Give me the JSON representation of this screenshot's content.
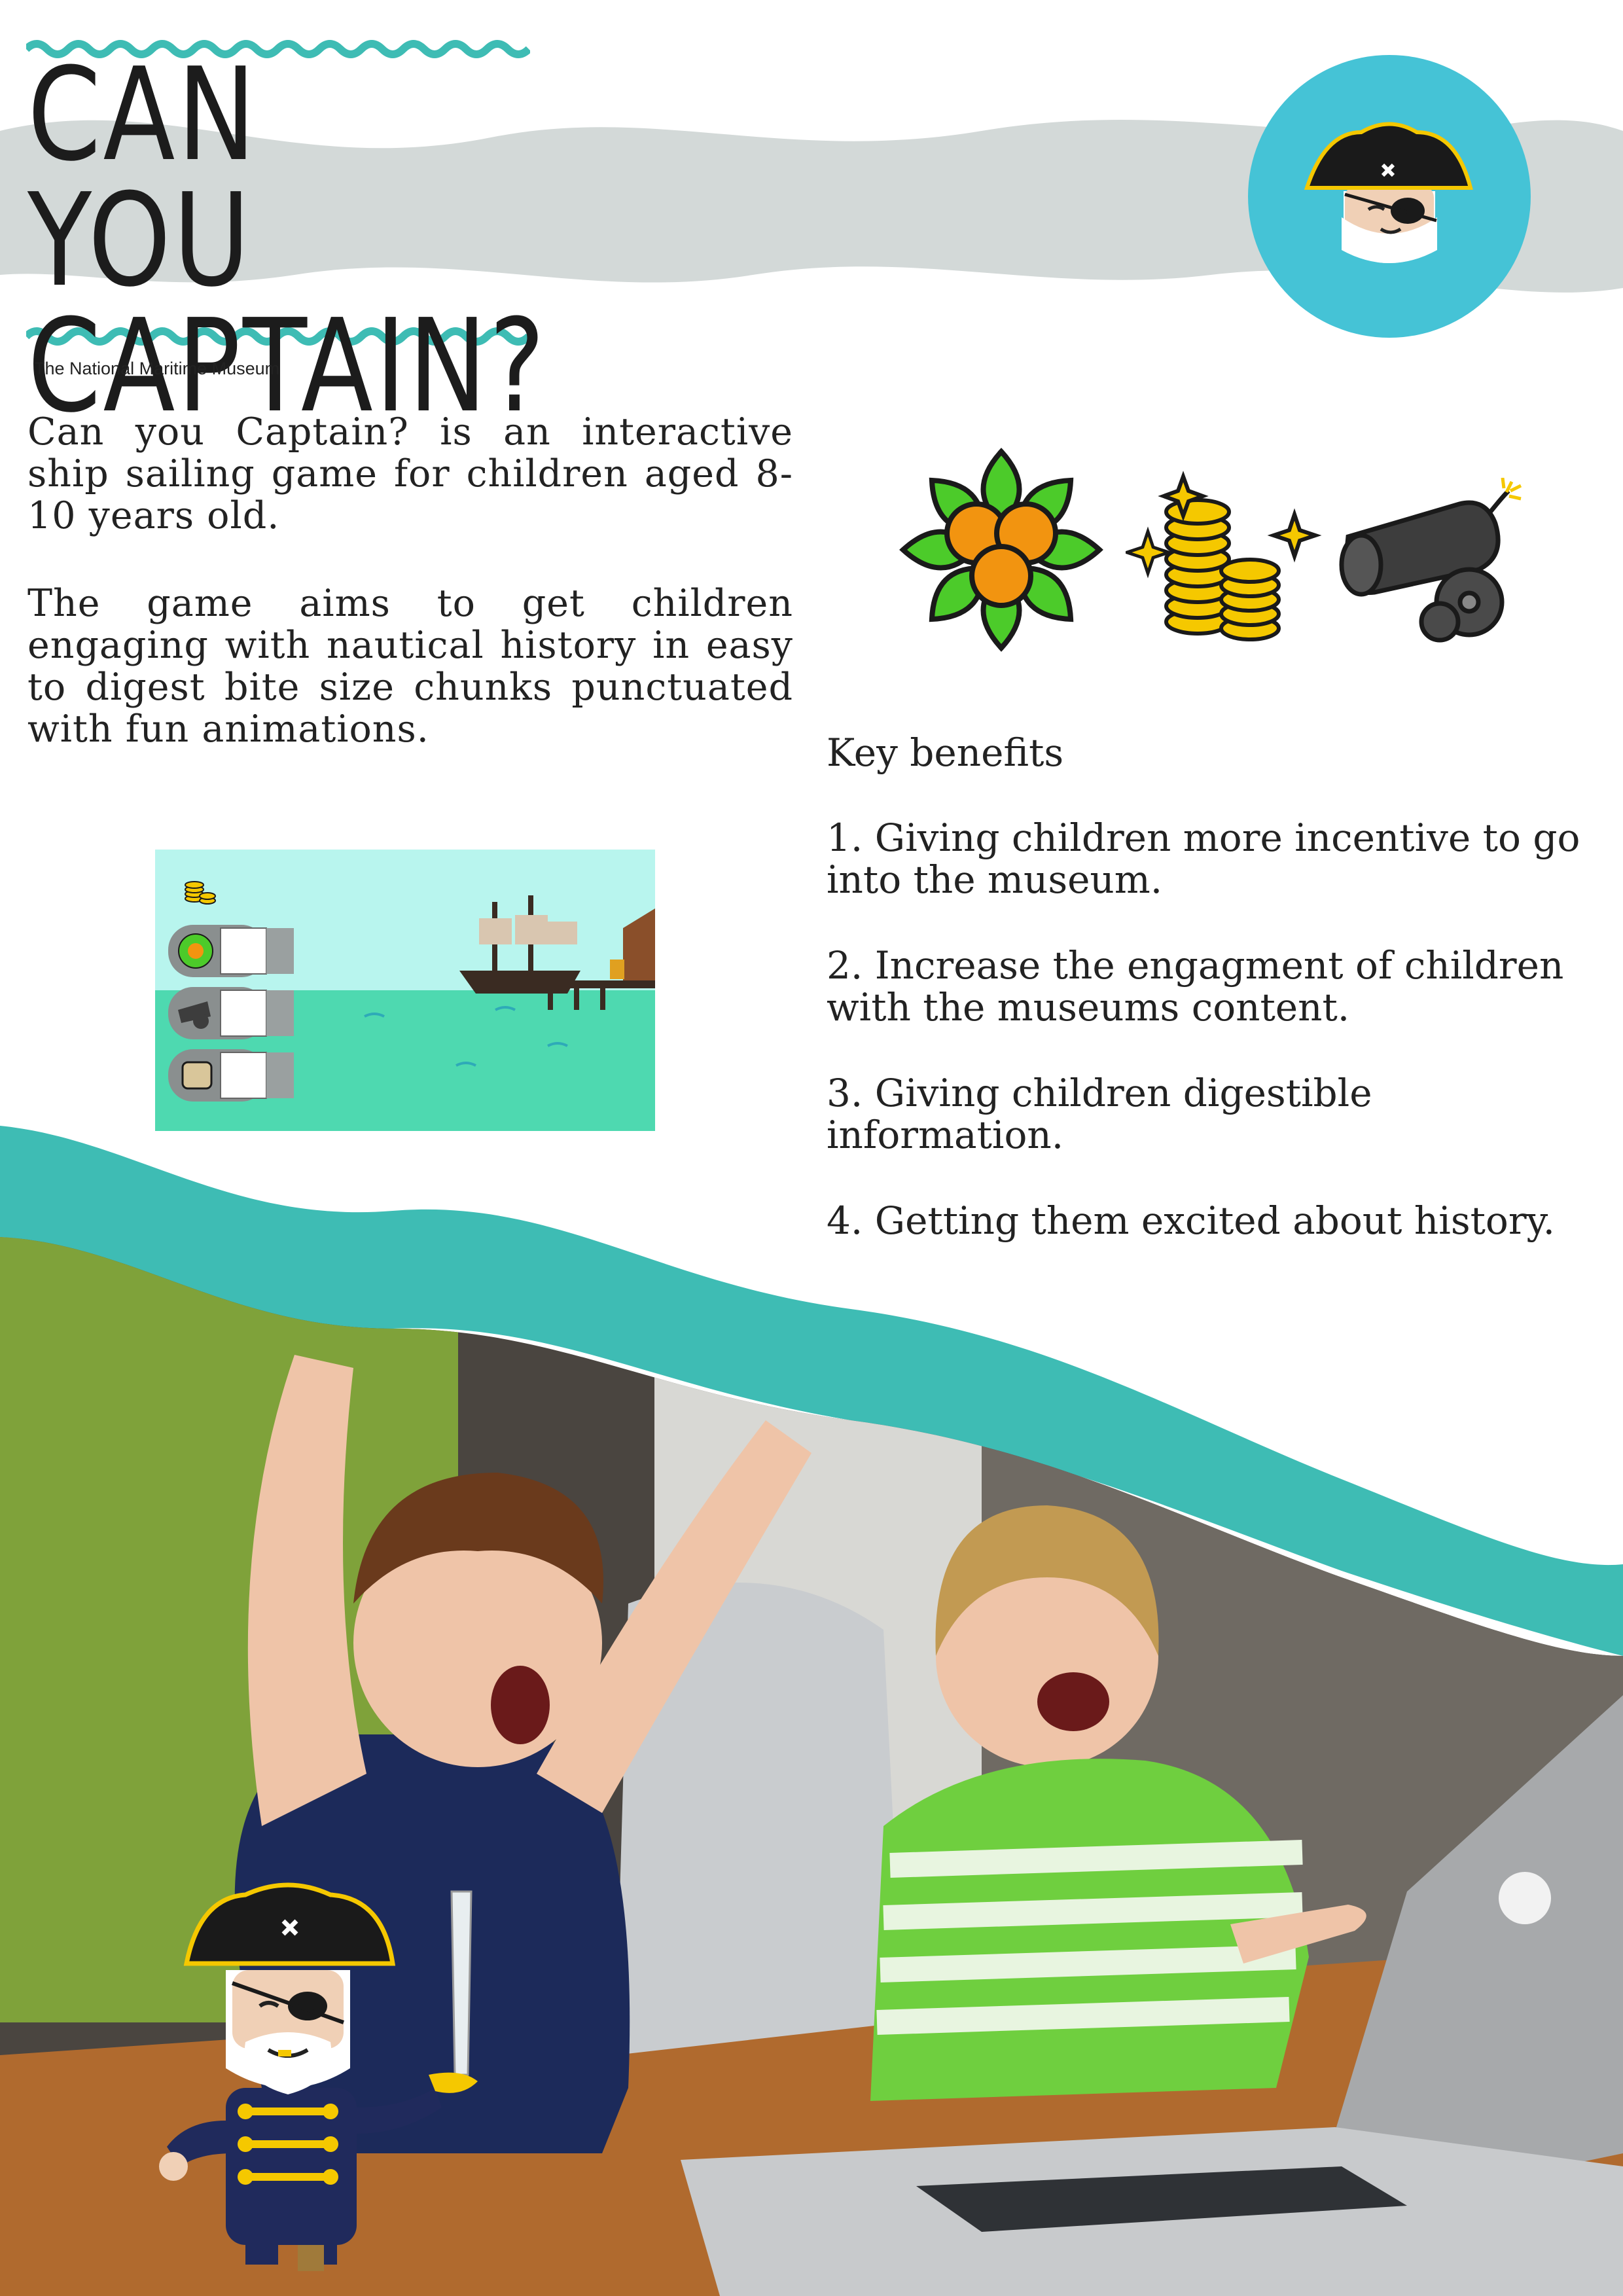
{
  "header": {
    "title_line1": "CAN YOU",
    "title_line2": "CAPTAIN?",
    "subtitle": "The National Maritime Museum"
  },
  "intro": {
    "paragraph1": "Can you Captain? is an interactive ship sailing game for children aged 8-10 years old.",
    "paragraph2": "The game aims to get children engaging with nautical history in easy to digest bite size chunks punctuated with fun animations."
  },
  "benefits": {
    "heading": "Key benefits",
    "items": [
      "1. Giving children more incentive to go into the museum.",
      "2. Increase the engagment of children with the museums content.",
      "3. Giving children digestible information.",
      "4. Getting them excited about history."
    ]
  },
  "icons": [
    "pirate-captain-icon",
    "flower-icon",
    "gold-coins-icon",
    "cannon-icon"
  ],
  "colors": {
    "teal": "#3ebcb4",
    "light_teal": "#45c3d6",
    "grey_band": "#d3d9d8",
    "coin_gold": "#f5c800",
    "leaf_green": "#4ccb2a",
    "flower_orange": "#f29410",
    "cannon_grey": "#3d3d3d"
  }
}
